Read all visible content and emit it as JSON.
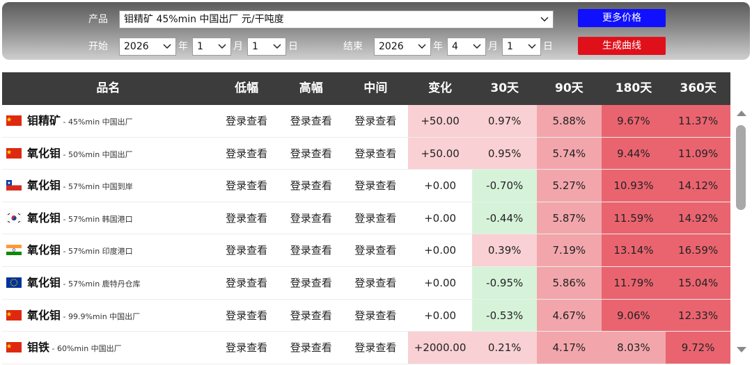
{
  "filters": {
    "product_label": "产品",
    "product_value": "钼精矿 45%min 中国出厂 元/干吨度",
    "more_prices_label": "更多价格",
    "start_label": "开始",
    "start_year": "2026",
    "start_month": "1",
    "start_day": "1",
    "end_label": "结束",
    "end_year": "2026",
    "end_month": "4",
    "end_day": "1",
    "year_unit": "年",
    "month_unit": "月",
    "day_unit": "日",
    "generate_label": "生成曲线"
  },
  "table": {
    "headers": [
      "品名",
      "低幅",
      "高幅",
      "中间",
      "变化",
      "30天",
      "90天",
      "180天",
      "360天"
    ],
    "rows": [
      {
        "flag": "cn-flag",
        "name": "钼精矿",
        "spec": " - 45%min 中国出厂",
        "low": "登录查看",
        "high": "登录查看",
        "mid": "登录查看",
        "change": "+50.00",
        "d30": "0.97%",
        "d90": "5.88%",
        "d180": "9.67%",
        "d360": "11.37%"
      },
      {
        "flag": "cn-flag",
        "name": "氧化钼",
        "spec": " - 50%min 中国出厂",
        "low": "登录查看",
        "high": "登录查看",
        "mid": "登录查看",
        "change": "+50.00",
        "d30": "0.95%",
        "d90": "5.74%",
        "d180": "9.44%",
        "d360": "11.09%"
      },
      {
        "flag": "cl-flag",
        "name": "氧化钼",
        "spec": " - 57%min 中国到岸",
        "low": "登录查看",
        "high": "登录查看",
        "mid": "登录查看",
        "change": "+0.00",
        "d30": "-0.70%",
        "d90": "5.27%",
        "d180": "10.93%",
        "d360": "14.12%"
      },
      {
        "flag": "kr-flag",
        "name": "氧化钼",
        "spec": " - 57%min 韩国港口",
        "low": "登录查看",
        "high": "登录查看",
        "mid": "登录查看",
        "change": "+0.00",
        "d30": "-0.44%",
        "d90": "5.87%",
        "d180": "11.59%",
        "d360": "14.92%"
      },
      {
        "flag": "in-flag",
        "name": "氧化钼",
        "spec": " - 57%min 印度港口",
        "low": "登录查看",
        "high": "登录查看",
        "mid": "登录查看",
        "change": "+0.00",
        "d30": "0.39%",
        "d90": "7.19%",
        "d180": "13.14%",
        "d360": "16.59%"
      },
      {
        "flag": "eu-flag",
        "name": "氧化钼",
        "spec": " - 57%min 鹿特丹仓库",
        "low": "登录查看",
        "high": "登录查看",
        "mid": "登录查看",
        "change": "+0.00",
        "d30": "-0.95%",
        "d90": "5.86%",
        "d180": "11.79%",
        "d360": "15.04%"
      },
      {
        "flag": "cn-flag",
        "name": "氧化钼",
        "spec": " - 99.9%min 中国出厂",
        "low": "登录查看",
        "high": "登录查看",
        "mid": "登录查看",
        "change": "+0.00",
        "d30": "-0.53%",
        "d90": "4.67%",
        "d180": "9.06%",
        "d360": "12.33%"
      },
      {
        "flag": "cn-flag",
        "name": "钼铁",
        "spec": " - 60%min 中国出厂",
        "low": "登录查看",
        "high": "登录查看",
        "mid": "登录查看",
        "change": "+2000.00",
        "d30": "0.21%",
        "d90": "4.17%",
        "d180": "8.03%",
        "d360": "9.72%"
      }
    ]
  },
  "colors": {
    "header_bg": "#3c3c3c",
    "more_prices_button": "#1010ff",
    "generate_button": "#e0101a",
    "positive_pale": "#f9d0d3",
    "positive_mid": "#f2a6ab",
    "positive_strong": "#ea6470",
    "negative_pale": "#d6f3da"
  }
}
